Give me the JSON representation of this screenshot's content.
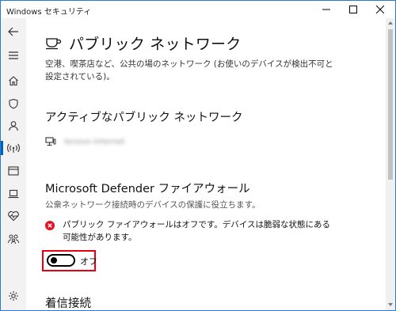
{
  "window": {
    "title": "Windows セキュリティ",
    "controls": {
      "minimize": "minimize-icon",
      "maximize": "maximize-icon",
      "close": "close-icon"
    }
  },
  "nav": {
    "items": [
      {
        "name": "back",
        "icon": "back-arrow-icon"
      },
      {
        "name": "menu",
        "icon": "hamburger-menu-icon"
      },
      {
        "name": "home",
        "icon": "home-icon"
      },
      {
        "name": "virus-protection",
        "icon": "shield-icon"
      },
      {
        "name": "account-protection",
        "icon": "person-icon"
      },
      {
        "name": "firewall-network",
        "icon": "wireless-signal-icon",
        "active": true
      },
      {
        "name": "app-browser-control",
        "icon": "browser-window-icon"
      },
      {
        "name": "device-security",
        "icon": "laptop-icon"
      },
      {
        "name": "device-performance",
        "icon": "heart-pulse-icon"
      },
      {
        "name": "family-options",
        "icon": "family-icon"
      },
      {
        "name": "settings",
        "icon": "gear-icon"
      }
    ]
  },
  "page": {
    "icon": "coffee-cup-icon",
    "title": "パブリック ネットワーク",
    "description": "空港、喫茶店など、公共の場のネットワーク (お使いのデバイスが検出不可と設定されている)。"
  },
  "active_networks": {
    "title": "アクティブなパブリック ネットワーク",
    "network_icon": "network-computer-icon",
    "network_name": "lenovo-internet"
  },
  "firewall": {
    "title": "Microsoft Defender ファイアウォール",
    "description": "公衆ネットワーク接続時のデバイスの保護に役立ちます。",
    "warning_icon": "error-circle-icon",
    "warning_text": "パブリック ファイアウォールはオフです。デバイスは脆弱な状態にある可能性があります。",
    "toggle": {
      "state": "off",
      "label": "オフ"
    },
    "colors": {
      "warning": "#e81123",
      "highlight": "#e60012",
      "accent": "#0063b1"
    }
  },
  "incoming": {
    "title": "着信接続"
  }
}
